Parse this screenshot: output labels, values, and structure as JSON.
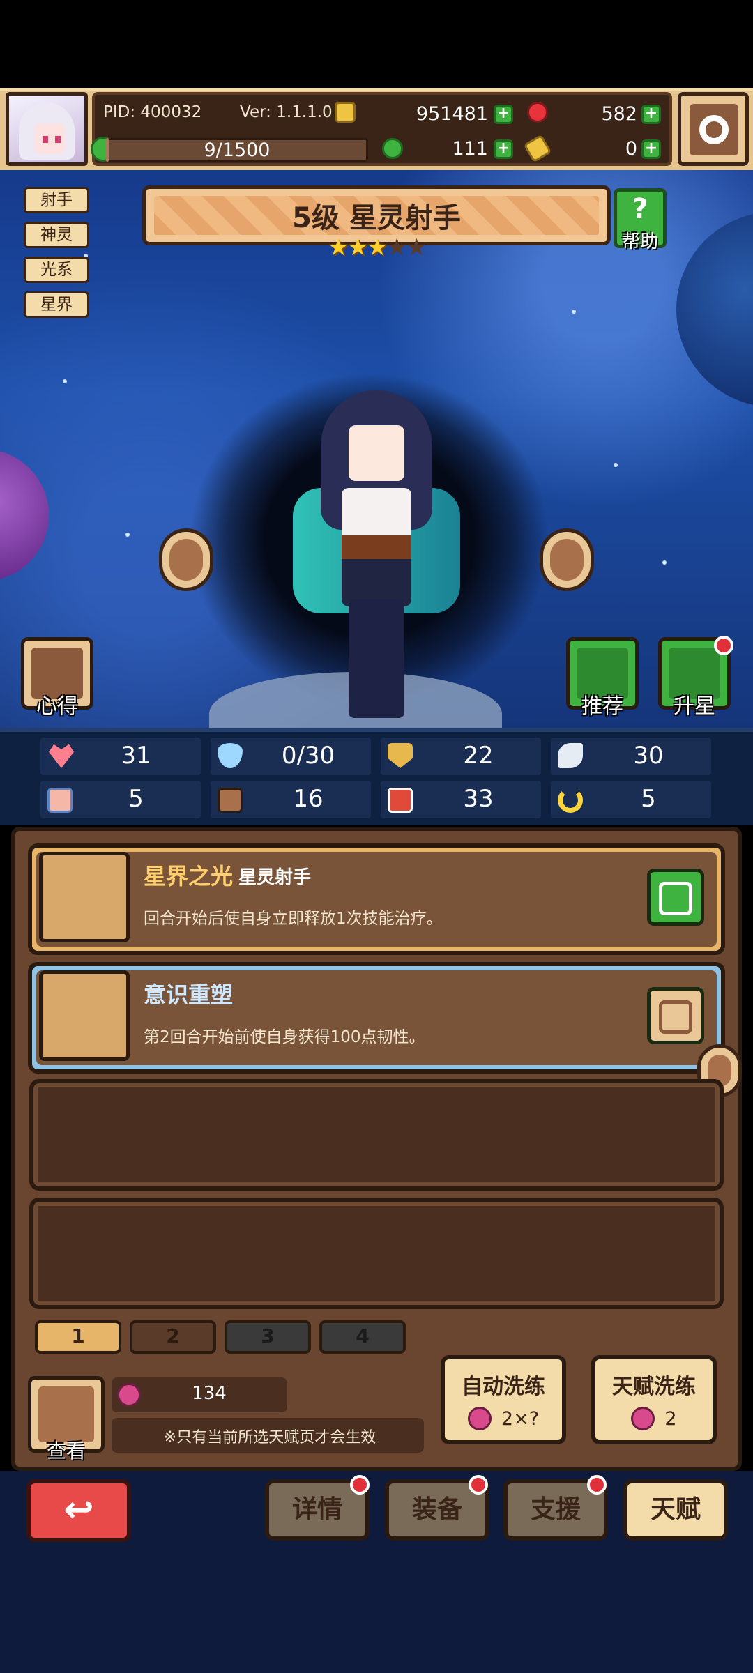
{
  "header": {
    "pid": "PID: 400032",
    "version": "Ver: 1.1.1.0",
    "gold": "951481",
    "gems": "582",
    "clover": "111",
    "key": "0",
    "energy": "9/1500",
    "energy_fraction": 0.006
  },
  "hero": {
    "title": "5级 星灵射手",
    "stars_filled": 3,
    "stars_total": 5,
    "tags": [
      "射手",
      "神灵",
      "光系",
      "星界"
    ],
    "help_label": "帮助",
    "left_button_label": "心得",
    "recommend_label": "推荐",
    "upgrade_label": "升星"
  },
  "stats": [
    {
      "icon": "heart-icon",
      "value": "31",
      "color": "#ff7f8f"
    },
    {
      "icon": "water-drop-icon",
      "value": "0/30",
      "color": "#9fd8ff"
    },
    {
      "icon": "shield-icon",
      "value": "22",
      "color": "#e7b84e"
    },
    {
      "icon": "wing-icon",
      "value": "30",
      "color": "#e6ecf4"
    },
    {
      "icon": "fist-icon",
      "value": "5",
      "color": "#f4b7a8"
    },
    {
      "icon": "book-icon",
      "value": "16",
      "color": "#a8714b"
    },
    {
      "icon": "potion-icon",
      "value": "33",
      "color": "#e04a3a"
    },
    {
      "icon": "horseshoe-icon",
      "value": "5",
      "color": "#ffd43a"
    }
  ],
  "talents": [
    {
      "name": "星界之光",
      "sub": "星灵射手",
      "desc": "回合开始后使自身立即释放1次技能治疗。",
      "locked": true,
      "icon": "star-talent-icon"
    },
    {
      "name": "意识重塑",
      "sub": "",
      "desc": "第2回合开始前使自身获得100点韧性。",
      "locked": false,
      "icon": "cross-talent-icon"
    }
  ],
  "pages": [
    "1",
    "2",
    "3",
    "4"
  ],
  "active_page": "1",
  "seed_count": "134",
  "note": "※只有当前所选天赋页才会生效",
  "view_label": "查看",
  "auto_wash": {
    "title": "自动洗练",
    "cost": "2×?"
  },
  "talent_wash": {
    "title": "天赋洗练",
    "cost": "2"
  },
  "nav": {
    "details": "详情",
    "equip": "装备",
    "support": "支援",
    "talent": "天赋"
  }
}
